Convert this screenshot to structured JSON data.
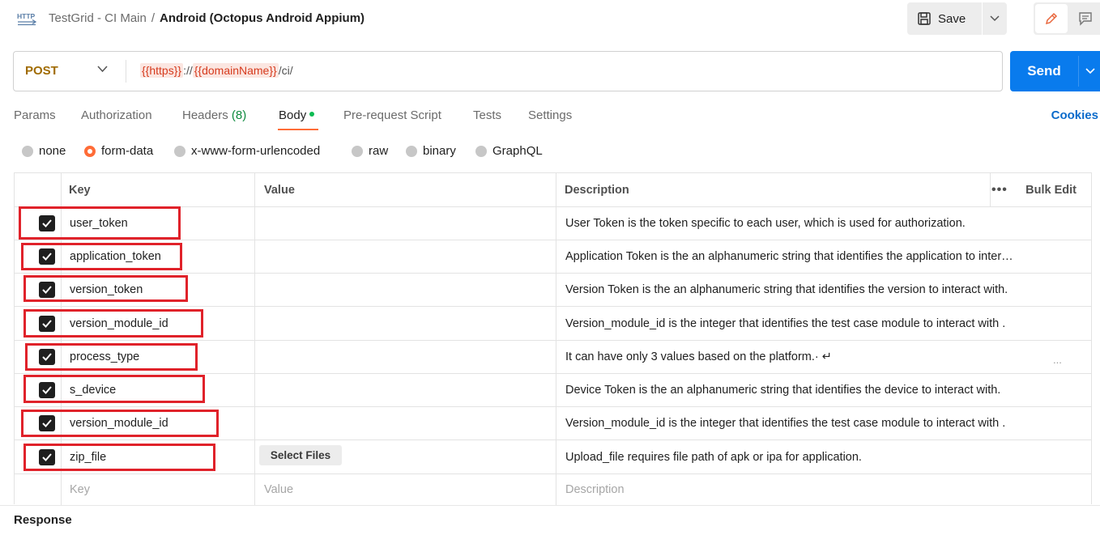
{
  "header": {
    "collection": "TestGrid - CI Main",
    "separator": "/",
    "request_name": "Android (Octopus Android Appium)",
    "save_label": "Save",
    "icon": "http-icon"
  },
  "request": {
    "method": "POST",
    "url_var1": "{{https}}",
    "url_sep": "://",
    "url_var2": "{{domainName}}",
    "url_path": "/ci/",
    "send_label": "Send"
  },
  "tabs": [
    {
      "label": "Params"
    },
    {
      "label": "Authorization"
    },
    {
      "label": "Headers",
      "count": "(8)"
    },
    {
      "label": "Body"
    },
    {
      "label": "Pre-request Script"
    },
    {
      "label": "Tests"
    },
    {
      "label": "Settings"
    }
  ],
  "cookies_label": "Cookies",
  "body_types": [
    "none",
    "form-data",
    "x-www-form-urlencoded",
    "raw",
    "binary",
    "GraphQL"
  ],
  "body_type_selected": "form-data",
  "table": {
    "headers": {
      "key": "Key",
      "value": "Value",
      "description": "Description",
      "bulk_edit": "Bulk Edit",
      "more": "•••"
    },
    "rows": [
      {
        "key": "user_token",
        "value": "",
        "description": "User Token is the token specific to each user, which is used for authorization.",
        "checked": true
      },
      {
        "key": "application_token",
        "value": "",
        "description": "Application Token is the an alphanumeric string that identifies the application to inter…",
        "checked": true
      },
      {
        "key": "version_token",
        "value": "",
        "description": "Version Token is the an alphanumeric string that identifies the version to interact with.",
        "checked": true
      },
      {
        "key": "version_module_id",
        "value": "",
        "description": "Version_module_id is the integer that identifies the test case module to interact with .",
        "checked": true
      },
      {
        "key": "process_type",
        "value": "",
        "description": "It can have only 3 values based on the platform.· ↵",
        "more": "...",
        "checked": true
      },
      {
        "key": "s_device",
        "value": "",
        "description": "Device Token is the an alphanumeric string that identifies the device to interact with.",
        "checked": true
      },
      {
        "key": "version_module_id",
        "value": "",
        "description": "Version_module_id is the integer that identifies the test case module to interact with .",
        "checked": true
      },
      {
        "key": "zip_file",
        "value": "Select Files",
        "description": "Upload_file requires file path of apk or ipa for application.",
        "checked": true
      }
    ],
    "placeholder": {
      "key": "Key",
      "value": "Value",
      "description": "Description"
    }
  },
  "response_label": "Response",
  "colors": {
    "accent": "#ff6c37",
    "send": "#097bed",
    "method": "#a06b00",
    "annotation": "#e0222a"
  }
}
